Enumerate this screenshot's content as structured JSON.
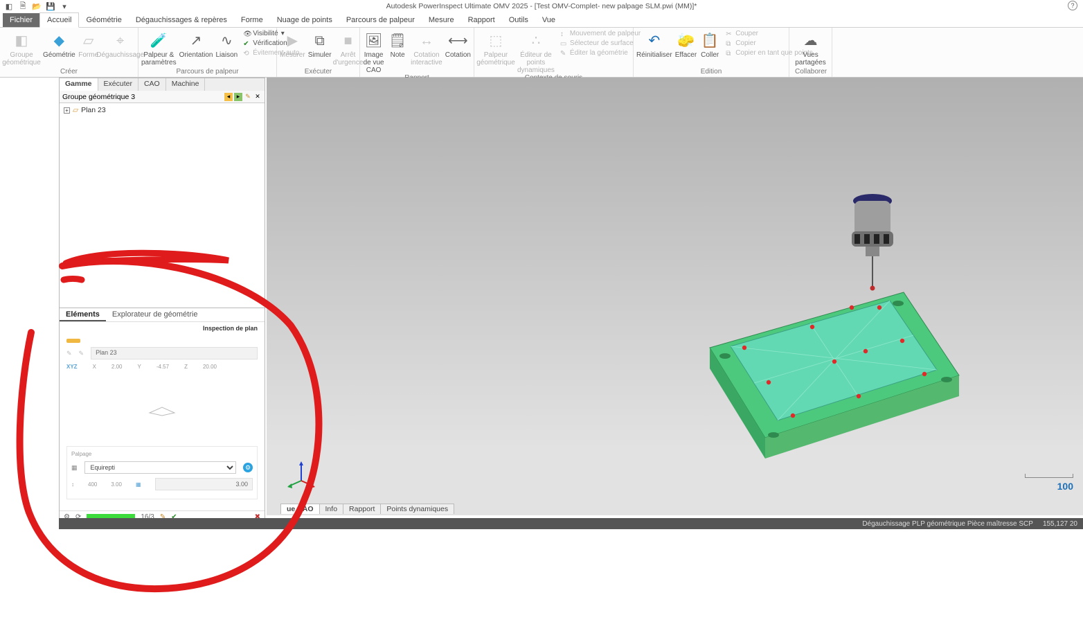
{
  "app": {
    "title": "Autodesk PowerInspect Ultimate OMV 2025 - [Test OMV-Complet- new palpage SLM.pwi (MM)]*"
  },
  "tabs": {
    "file": "Fichier",
    "items": [
      "Accueil",
      "Géométrie",
      "Dégauchissages & repères",
      "Forme",
      "Nuage de points",
      "Parcours de palpeur",
      "Mesure",
      "Rapport",
      "Outils",
      "Vue"
    ],
    "active": "Accueil"
  },
  "ribbon": {
    "groups": {
      "creer": {
        "label": "Créer",
        "groupe_geo": "Groupe géométrique",
        "geometrie": "Géométrie",
        "forme": "Forme",
        "degauch": "Dégauchissage"
      },
      "palpeur": {
        "label": "Parcours de palpeur",
        "palpeur_param": "Palpeur & paramètres",
        "orientation": "Orientation",
        "liaison": "Liaison",
        "visibilite": "Visibilité",
        "verification": "Vérification",
        "evit_auto": "Évitement-auto"
      },
      "executer": {
        "label": "Exécuter",
        "mesurer": "Mesurer",
        "simuler": "Simuler",
        "arret": "Arrêt d'urgence"
      },
      "rapport": {
        "label": "Rapport",
        "image_cao": "Image de vue CAO",
        "note": "Note",
        "cotation_inter": "Cotation interactive",
        "cotation": "Cotation"
      },
      "souris": {
        "label": "Contexte de souris",
        "palpeur_geo": "Palpeur géométrique",
        "editeur_pts": "Éditeur de points dynamiques",
        "mvt_palpeur": "Mouvement de palpeur",
        "sel_surface": "Sélecteur de surface",
        "edit_geom": "Éditer la géométrie"
      },
      "edition": {
        "label": "Edition",
        "reinit": "Réinitialiser",
        "effacer": "Effacer",
        "coller": "Coller",
        "couper": "Couper",
        "copier": "Copier",
        "copier_pts": "Copier en tant que points"
      },
      "collab": {
        "label": "Collaborer",
        "vues": "Vues partagées"
      }
    }
  },
  "left_panel": {
    "tabs": [
      "Gamme",
      "Exécuter",
      "CAO",
      "Machine"
    ],
    "active": "Gamme",
    "combo": "Groupe géométrique 3",
    "tree_item": "Plan 23"
  },
  "props": {
    "tabs": [
      "Eléments",
      "Explorateur de géométrie"
    ],
    "active": "Eléments",
    "head": "Inspection de plan",
    "name_value": "Plan 23",
    "xyz_label": "XYZ",
    "x": "2.00",
    "y": "-4.57",
    "z": "20.00",
    "x_lab": "X",
    "y_lab": "Y",
    "z_lab": "Z",
    "palpage_label": "Palpage",
    "strategy": "Equirepti",
    "u_val": "400",
    "v_val": "3.00",
    "w_val": "3.00",
    "progress": "16/3"
  },
  "viewport": {
    "bottom_tabs": [
      "ue CAO",
      "Info",
      "Rapport",
      "Points dynamiques"
    ],
    "active_bt": "ue CAO",
    "scale": "100"
  },
  "status": {
    "text": "Dégauchissage PLP géométrique Pièce maîtresse  SCP",
    "coords": "155,127    20"
  }
}
